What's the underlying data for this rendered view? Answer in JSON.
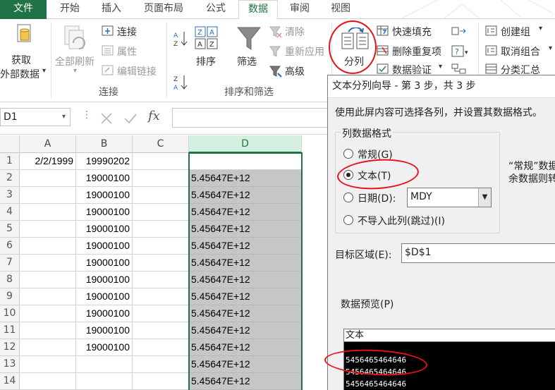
{
  "tabs": [
    "文件",
    "开始",
    "插入",
    "页面布局",
    "公式",
    "数据",
    "审阅",
    "视图"
  ],
  "ribbon": {
    "get_external": [
      "获取",
      "外部数据"
    ],
    "refresh_all": "全部刷新",
    "connections": "连接",
    "properties": "属性",
    "edit_links": "编辑链接",
    "group_connections": "连接",
    "sort_az": "A↓Z",
    "sort_za": "Z↓A",
    "sort": "排序",
    "filter": "筛选",
    "clear": "清除",
    "reapply": "重新应用",
    "advanced": "高级",
    "group_sort_filter": "排序和筛选",
    "split": "分列",
    "flash_fill": "快速填充",
    "remove_duplicates": "删除重复项",
    "data_validation": "数据验证",
    "create_group": "创建组",
    "ungroup": "取消组合",
    "subtotal": "分类汇总"
  },
  "formula_bar": {
    "name_box": "D1",
    "fx": "fx"
  },
  "grid": {
    "columns": [
      "A",
      "B",
      "C",
      "D"
    ],
    "rows": [
      "1",
      "2",
      "3",
      "4",
      "5",
      "6",
      "7",
      "8",
      "9",
      "10",
      "11",
      "12",
      "13",
      "14"
    ],
    "colA": [
      "2/2/1999",
      "",
      "",
      "",
      "",
      "",
      "",
      "",
      "",
      "",
      "",
      "",
      "",
      ""
    ],
    "colB": [
      "19990202",
      "19000100",
      "19000100",
      "19000100",
      "19000100",
      "19000100",
      "19000100",
      "19000100",
      "19000100",
      "19000100",
      "19000100",
      "19000100",
      "",
      ""
    ],
    "colD": [
      "",
      "5.45647E+12",
      "5.45647E+12",
      "5.45647E+12",
      "5.45647E+12",
      "5.45647E+12",
      "5.45647E+12",
      "5.45647E+12",
      "5.45647E+12",
      "5.45647E+12",
      "5.45647E+12",
      "5.45647E+12",
      "5.45647E+12",
      "5.45647E+12"
    ]
  },
  "dialog": {
    "title": "文本分列向导 - 第 3 步，共 3 步",
    "instruction": "使用此屏内容可选择各列，并设置其数据格式。",
    "format_label": "列数据格式",
    "opt_general": "常规(G)",
    "opt_text": "文本(T)",
    "opt_date": "日期(D):",
    "date_value": "MDY",
    "opt_skip": "不导入此列(跳过)(I)",
    "side_note_1": "“常规”数据",
    "side_note_2": "余数据则转",
    "dest_label": "目标区域(E):",
    "dest_value": "$D$1",
    "preview_label": "数据预览(P)",
    "preview_head": "文本",
    "preview_rows": [
      "5456465464646",
      "5456465464646",
      "5456465464646"
    ]
  }
}
